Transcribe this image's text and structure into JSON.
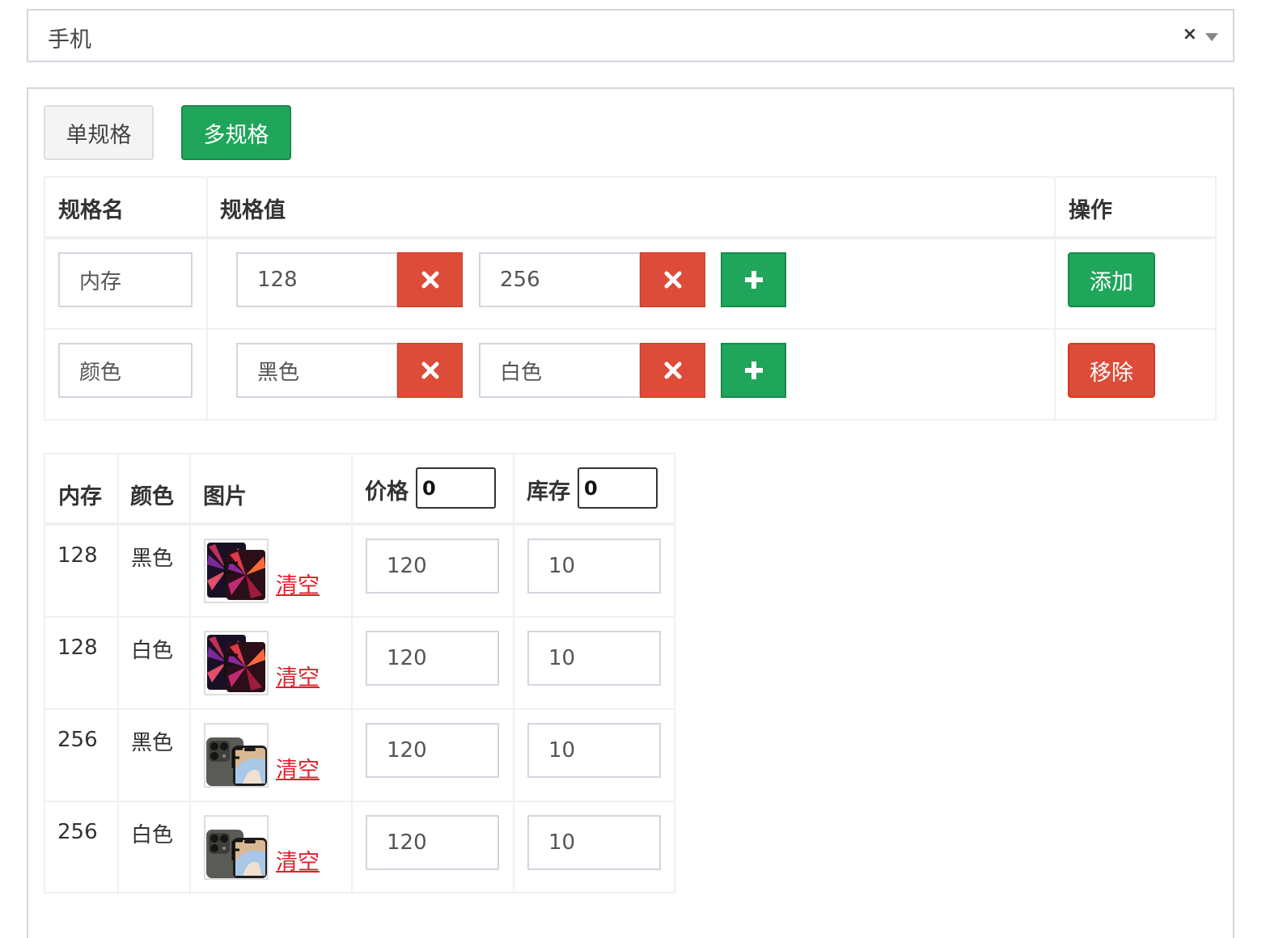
{
  "category_select": {
    "value": "手机",
    "clear": "×"
  },
  "mode_buttons": {
    "single": "单规格",
    "multi": "多规格"
  },
  "spec_table": {
    "headers": {
      "name": "规格名",
      "values": "规格值",
      "actions": "操作"
    },
    "rows": [
      {
        "name": "内存",
        "values": [
          "128",
          "256"
        ],
        "action": "添加"
      },
      {
        "name": "颜色",
        "values": [
          "黑色",
          "白色"
        ],
        "action": "移除"
      }
    ]
  },
  "sku_table": {
    "headers": {
      "col1": "内存",
      "col2": "颜色",
      "image": "图片",
      "price": "价格",
      "stock": "库存"
    },
    "batch": {
      "price": "0",
      "stock": "0"
    },
    "clear_label": "清空",
    "rows": [
      {
        "memory": "128",
        "color": "黑色",
        "image": "ipad-pro-red",
        "price": "120",
        "stock": "10"
      },
      {
        "memory": "128",
        "color": "白色",
        "image": "ipad-pro-red",
        "price": "120",
        "stock": "10"
      },
      {
        "memory": "256",
        "color": "黑色",
        "image": "iphone-pro-graphite",
        "price": "120",
        "stock": "10"
      },
      {
        "memory": "256",
        "color": "白色",
        "image": "iphone-pro-graphite",
        "price": "120",
        "stock": "10"
      }
    ]
  },
  "colors": {
    "success": "#1fa65a",
    "danger": "#dd4b39",
    "link": "#e0202b"
  }
}
